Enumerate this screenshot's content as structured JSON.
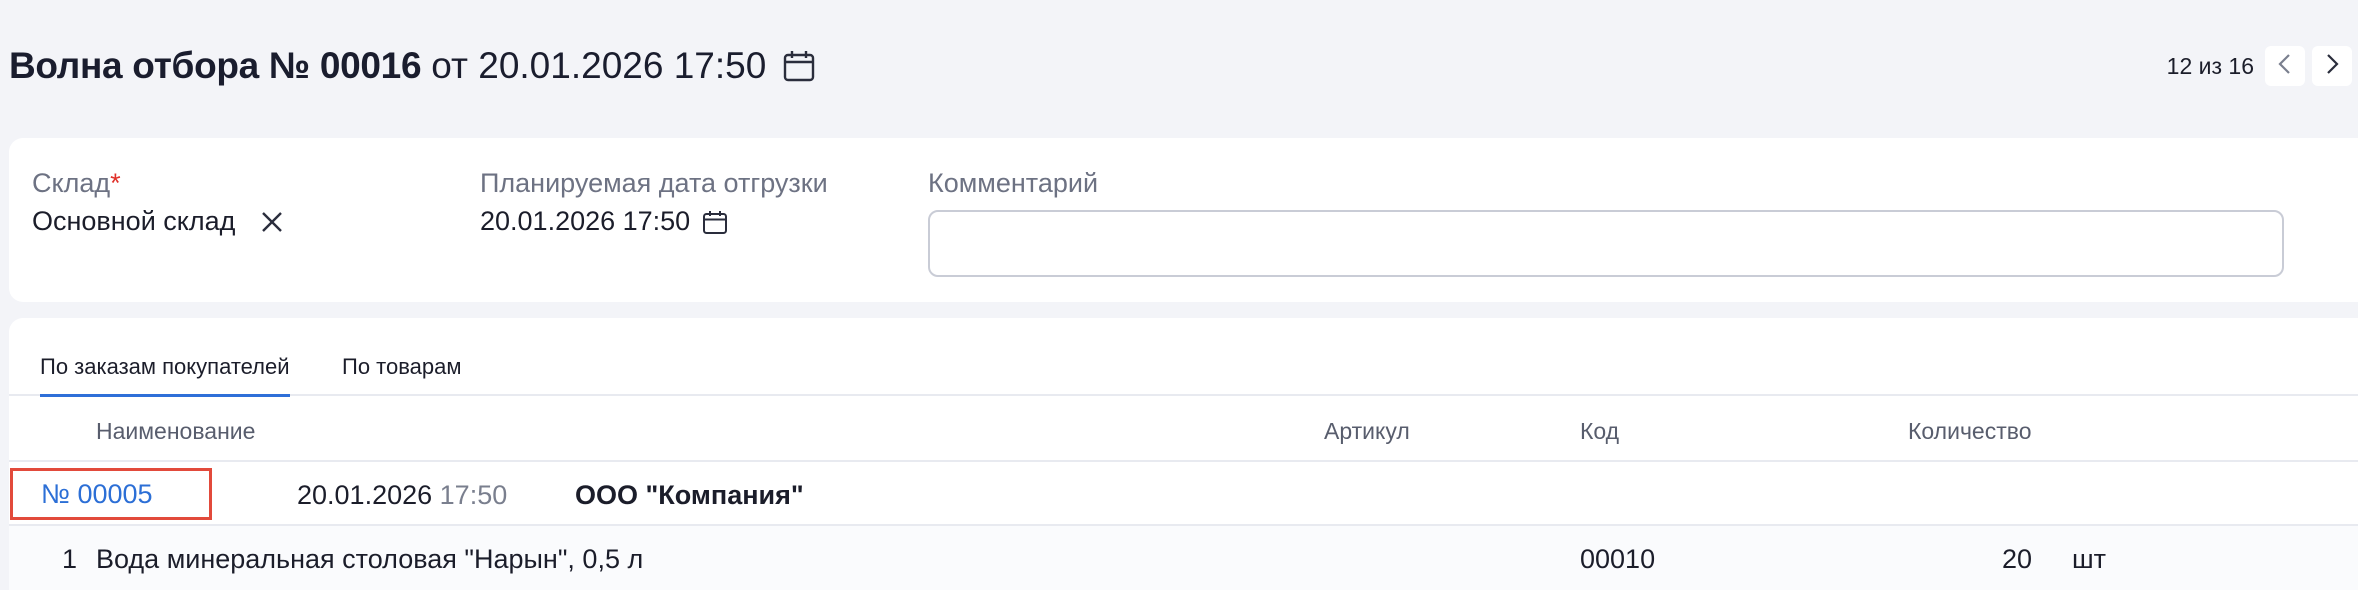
{
  "header": {
    "title": "Волна отбора № 00016",
    "subtitle": "от 20.01.2026 17:50",
    "calendar_icon": "calendar-icon"
  },
  "pager": {
    "text": "12 из 16",
    "prev_icon": "chevron-left-icon",
    "next_icon": "chevron-right-icon"
  },
  "form": {
    "warehouse": {
      "label": "Склад",
      "required_mark": "*",
      "value": "Основной склад",
      "clear_icon": "close-icon"
    },
    "ship_date": {
      "label": "Планируемая дата отгрузки",
      "value": "20.01.2026 17:50",
      "icon": "calendar-icon"
    },
    "comment": {
      "label": "Комментарий",
      "value": "",
      "placeholder": ""
    }
  },
  "tabs": [
    {
      "label": "По заказам покупателей",
      "active": true
    },
    {
      "label": "По товарам",
      "active": false
    }
  ],
  "table": {
    "columns": [
      "Наименование",
      "Артикул",
      "Код",
      "Количество"
    ],
    "groups": [
      {
        "order_number": "№ 00005",
        "date": "20.01.2026",
        "time": "17:50",
        "counterparty": "ООО \"Компания\"",
        "items": [
          {
            "index": "1",
            "name": "Вода минеральная столовая \"Нарын\", 0,5 л",
            "article": "",
            "code": "00010",
            "quantity": "20",
            "unit": "шт"
          }
        ]
      }
    ]
  },
  "colors": {
    "accent": "#2f6fd8",
    "link": "#2c6fd6",
    "highlight_border": "#e24a3b",
    "required": "#e0312a",
    "background": "#f3f4f8"
  }
}
